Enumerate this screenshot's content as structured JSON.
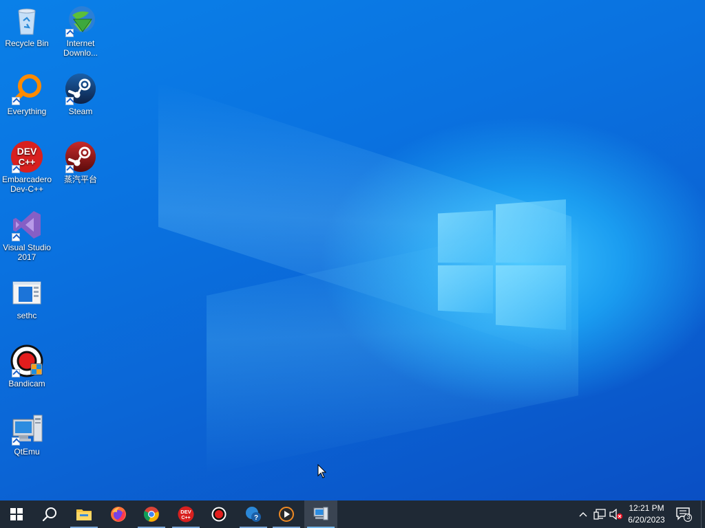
{
  "desktop": {
    "icons": [
      {
        "label": "Recycle Bin",
        "icon": "recycle-bin-icon"
      },
      {
        "label": "Internet Downlo...",
        "icon": "internet-download-manager-icon"
      },
      {
        "label": "Everything",
        "icon": "everything-search-icon"
      },
      {
        "label": "Steam",
        "icon": "steam-icon"
      },
      {
        "label": "Embarcadero Dev-C++",
        "icon": "dev-cpp-icon"
      },
      {
        "label": "蒸汽平台",
        "icon": "steam-china-icon"
      },
      {
        "label": "Visual Studio 2017",
        "icon": "visual-studio-icon"
      },
      {
        "label": "sethc",
        "icon": "sethc-icon"
      },
      {
        "label": "Bandicam",
        "icon": "bandicam-icon"
      },
      {
        "label": "QtEmu",
        "icon": "qtemu-icon"
      }
    ],
    "devcpp_badge": "DEV\nC++"
  },
  "taskbar": {
    "apps": [
      {
        "icon": "start-icon"
      },
      {
        "icon": "search-icon"
      },
      {
        "icon": "file-explorer-icon"
      },
      {
        "icon": "firefox-icon"
      },
      {
        "icon": "chrome-icon"
      },
      {
        "icon": "dev-cpp-icon"
      },
      {
        "icon": "record-icon"
      },
      {
        "icon": "get-help-icon"
      },
      {
        "icon": "media-player-icon"
      },
      {
        "icon": "qtemu-icon"
      }
    ],
    "devcpp_text": "DEV C++",
    "help_text": "?",
    "clock_time": "12:21 PM",
    "clock_date": "6/20/2023",
    "notification_count": "3"
  },
  "colors": {
    "taskbar": "#1f2935",
    "accent": "#0a78e6",
    "running_underline": "#7aa7d8"
  }
}
